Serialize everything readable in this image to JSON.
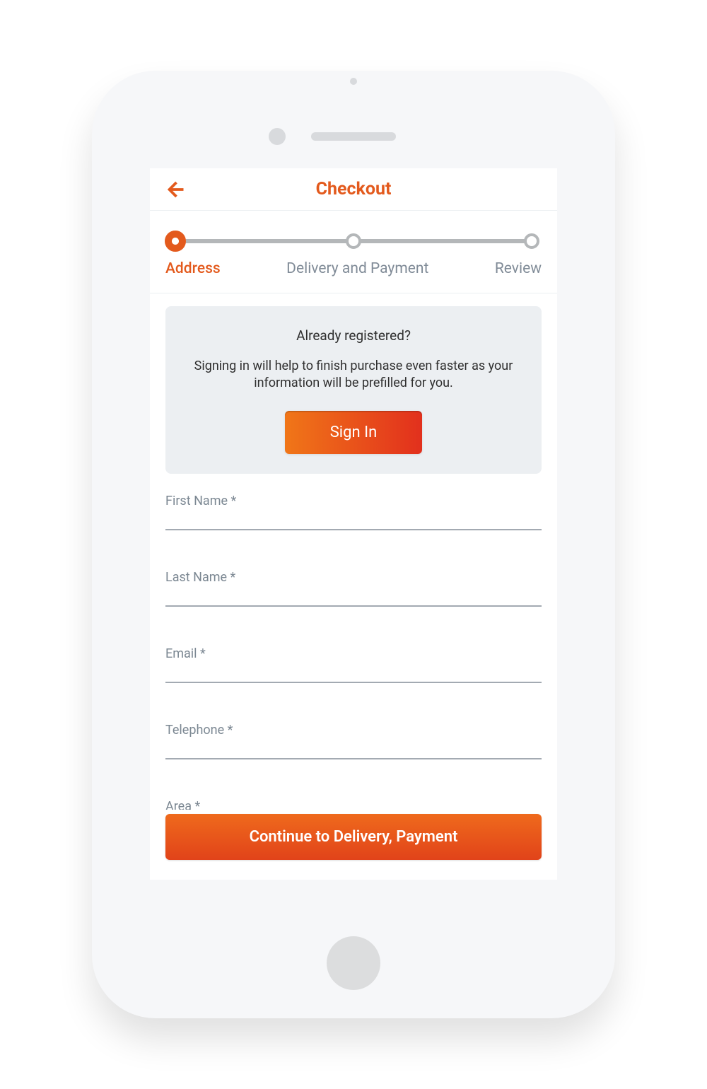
{
  "header": {
    "title": "Checkout"
  },
  "stepper": {
    "steps": [
      {
        "label": "Address",
        "active": true
      },
      {
        "label": "Delivery and Payment",
        "active": false
      },
      {
        "label": "Review",
        "active": false
      }
    ]
  },
  "signin_card": {
    "heading": "Already registered?",
    "body": "Signing in will help to finish purchase even faster as your information will be prefilled for you.",
    "button_label": "Sign In"
  },
  "form": {
    "fields": [
      {
        "label": "First Name *",
        "value": ""
      },
      {
        "label": "Last Name *",
        "value": ""
      },
      {
        "label": "Email *",
        "value": ""
      },
      {
        "label": "Telephone *",
        "value": ""
      },
      {
        "label": "Area *",
        "value": ""
      }
    ]
  },
  "footer": {
    "continue_label": "Continue to Delivery, Payment"
  }
}
